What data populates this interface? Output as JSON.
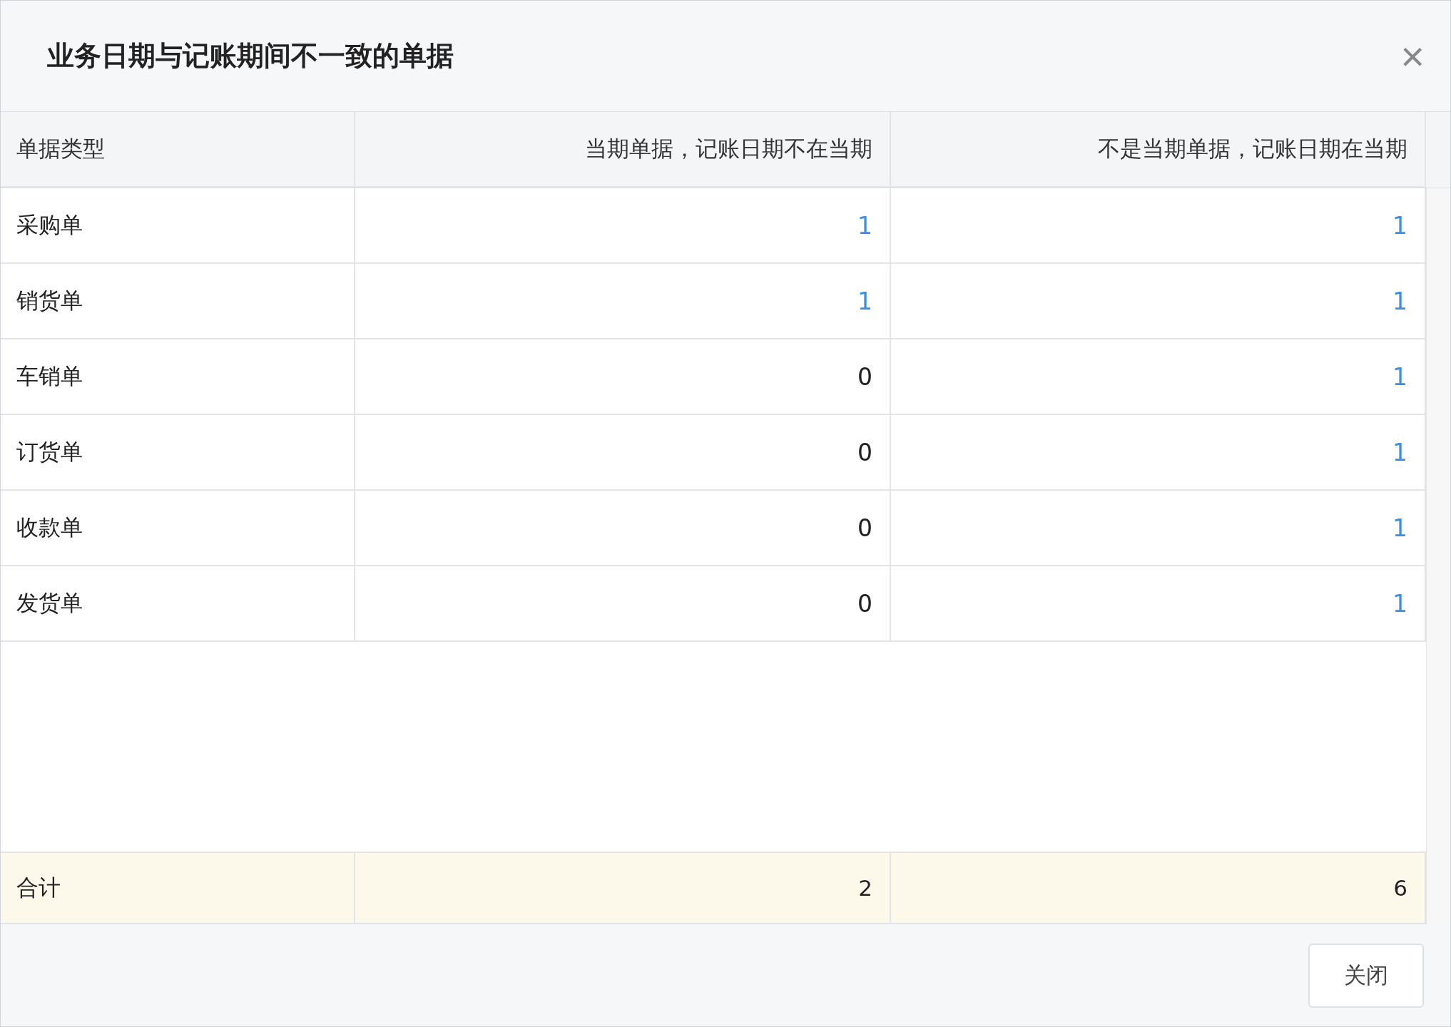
{
  "dialog": {
    "title": "业务日期与记账期间不一致的单据",
    "close": "×"
  },
  "table": {
    "columns": [
      "单据类型",
      "当期单据，记账日期不在当期",
      "不是当期单据，记账日期在当期"
    ],
    "rows": [
      {
        "type": "采购单",
        "current": {
          "value": "1",
          "linked": true
        },
        "other": {
          "value": "1",
          "linked": true
        }
      },
      {
        "type": "销货单",
        "current": {
          "value": "1",
          "linked": true
        },
        "other": {
          "value": "1",
          "linked": true
        }
      },
      {
        "type": "车销单",
        "current": {
          "value": "0",
          "linked": false
        },
        "other": {
          "value": "1",
          "linked": true
        }
      },
      {
        "type": "订货单",
        "current": {
          "value": "0",
          "linked": false
        },
        "other": {
          "value": "1",
          "linked": true
        }
      },
      {
        "type": "收款单",
        "current": {
          "value": "0",
          "linked": false
        },
        "other": {
          "value": "1",
          "linked": true
        }
      },
      {
        "type": "发货单",
        "current": {
          "value": "0",
          "linked": false
        },
        "other": {
          "value": "1",
          "linked": true
        }
      }
    ],
    "total": {
      "label": "合计",
      "current": "2",
      "other": "6"
    }
  },
  "buttons": [
    "关闭"
  ]
}
